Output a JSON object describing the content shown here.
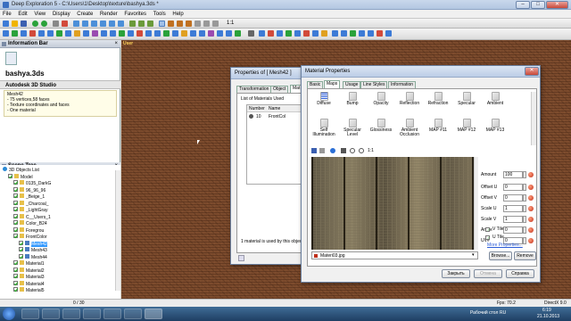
{
  "window": {
    "title": "Deep Exploration 5 - C:\\Users\\1\\Desktop\\texture\\bashya.3ds *",
    "min": "–",
    "max": "□",
    "close": "✕"
  },
  "menu": [
    "File",
    "Edit",
    "View",
    "Display",
    "Create",
    "Render",
    "Favorites",
    "Tools",
    "Help"
  ],
  "toolbar_text": "1:1",
  "info_bar": {
    "title": "Information Bar",
    "close": "×",
    "file_name": "bashya.3ds",
    "format": "Autodesk 3D Studio",
    "details": [
      "Mesh42",
      "- 75 vertices,58 faces",
      "- Texture coordinates and faces",
      "- One material"
    ]
  },
  "scene_tree": {
    "title": "Scene Tree",
    "close": "×",
    "items": [
      {
        "label": "3D Objects List",
        "indent": 0,
        "icon": "globe",
        "check": false
      },
      {
        "label": "Model",
        "indent": 1,
        "icon": "folder",
        "check": true
      },
      {
        "label": "0135_DarkG",
        "indent": 2,
        "icon": "folder",
        "check": true
      },
      {
        "label": "96_96_96",
        "indent": 2,
        "icon": "folder",
        "check": true
      },
      {
        "label": "_Beige_1",
        "indent": 2,
        "icon": "folder",
        "check": true
      },
      {
        "label": "_Charcoal_",
        "indent": 2,
        "icon": "folder",
        "check": true
      },
      {
        "label": "_LightGray",
        "indent": 2,
        "icon": "folder",
        "check": true
      },
      {
        "label": "C__Users_1",
        "indent": 2,
        "icon": "folder",
        "check": true
      },
      {
        "label": "Color_B24",
        "indent": 2,
        "icon": "folder",
        "check": true
      },
      {
        "label": "Foregrou",
        "indent": 2,
        "icon": "folder",
        "check": true
      },
      {
        "label": "FrontColor",
        "indent": 2,
        "icon": "folder",
        "check": true
      },
      {
        "label": "Mesh42",
        "indent": 3,
        "icon": "mesh",
        "check": true,
        "selected": true
      },
      {
        "label": "Mesh43",
        "indent": 3,
        "icon": "mesh",
        "check": true
      },
      {
        "label": "Mesh44",
        "indent": 3,
        "icon": "mesh",
        "check": true
      },
      {
        "label": "Material1",
        "indent": 2,
        "icon": "folder",
        "check": true
      },
      {
        "label": "Material2",
        "indent": 2,
        "icon": "folder",
        "check": true
      },
      {
        "label": "Material3",
        "indent": 2,
        "icon": "folder",
        "check": true
      },
      {
        "label": "Material4",
        "indent": 2,
        "icon": "folder",
        "check": true
      },
      {
        "label": "Material5",
        "indent": 2,
        "icon": "folder",
        "check": true
      }
    ]
  },
  "viewport": {
    "label": "User"
  },
  "properties": {
    "title": "Properties of  [ Mesh42 ]",
    "tabs": [
      "Transformation",
      "Object",
      "Mat"
    ],
    "group_label": "List of Materials Used",
    "col_number": "Number",
    "col_name": "Name",
    "rows": [
      {
        "number": "10",
        "name": "FrontCol"
      }
    ],
    "footer": "1 material is used by this objec"
  },
  "material": {
    "title": "Material Properties",
    "close": "✕",
    "tabs": [
      "Basic",
      "Maps",
      "Usage",
      "Line Styles",
      "Information"
    ],
    "maps": [
      "Diffuse",
      "Bump",
      "Opacity",
      "Reflection",
      "Refraction",
      "Specular",
      "Ambient",
      "Self Illumination",
      "Specular Level",
      "Glossiness",
      "Ambient Occlusion",
      "MAP #11",
      "MAP #12",
      "MAP #13"
    ],
    "amount_label": "Amount",
    "amount": "100",
    "offset_u_label": "Offset U",
    "offset_u": "0",
    "offset_v_label": "Offset V",
    "offset_v": "0",
    "scale_u_label": "Scale U",
    "scale_u": "1",
    "scale_v_label": "Scale V",
    "scale_v": "1",
    "angle_label": "Angle",
    "angle": "0",
    "uvw_label": "UV#",
    "uvw": "0",
    "vtile": "V Tile",
    "utile": "U Tile",
    "more": "More Properties...",
    "browse": "Browse...",
    "remove": "Remove",
    "file": "Materi03.jpg",
    "btn_close": "Закрыть",
    "btn_cancel": "Отмена",
    "btn_help": "Справка"
  },
  "statusbar": {
    "page": "0 / 30",
    "fps": "Fps: 70.2",
    "directx": "DirectX 9.0"
  },
  "taskbar": {
    "desktop": "Рабочий стол",
    "lang": "RU",
    "time": "6:19",
    "date": "21.10.2013"
  }
}
